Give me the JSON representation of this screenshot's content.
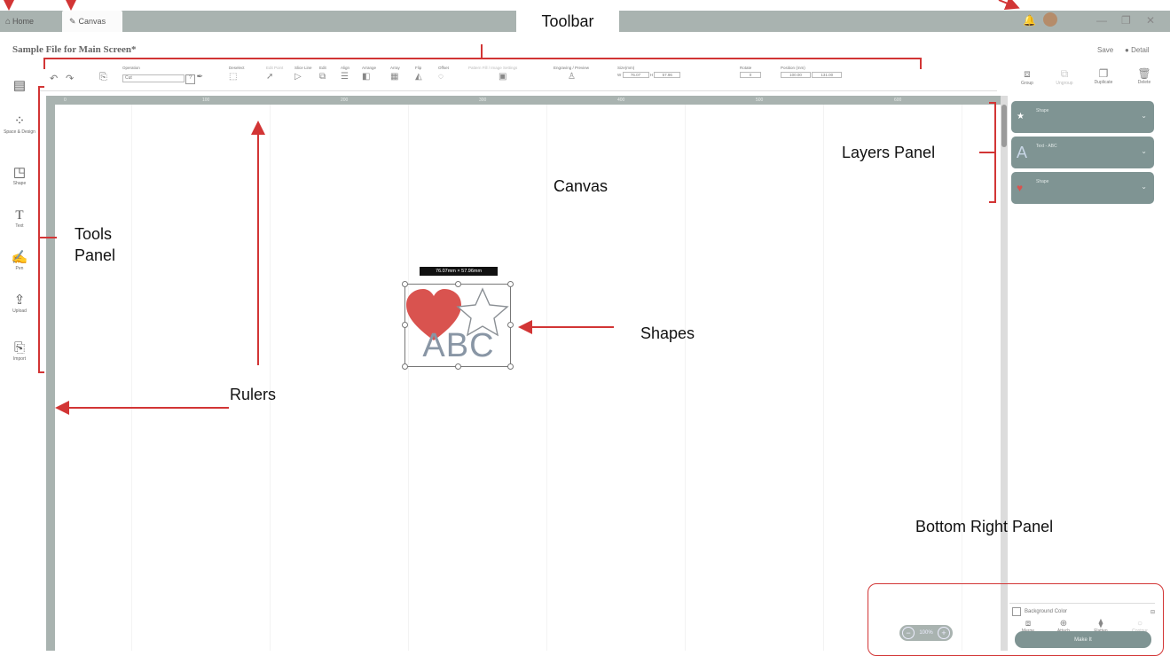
{
  "titlebar": {
    "tabs": [
      {
        "label": "Home",
        "icon": "home-icon"
      },
      {
        "label": "Canvas",
        "icon": "pencil-icon"
      }
    ],
    "window_controls": [
      "minimize-icon",
      "restore-icon",
      "close-icon"
    ]
  },
  "file": {
    "title": "Sample File for Main Screen*",
    "save_label": "Save",
    "detail_label": "Detail"
  },
  "toolbar": {
    "groups": [
      {
        "label": "Operation",
        "value": "Cut"
      },
      {
        "label": "Deselect"
      },
      {
        "label": "Edit Point"
      },
      {
        "label": "Slice Line"
      },
      {
        "label": "Edit"
      },
      {
        "label": "Align"
      },
      {
        "label": "Arrange"
      },
      {
        "label": "Array"
      },
      {
        "label": "Flip"
      },
      {
        "label": "Offset"
      },
      {
        "label": "Pattern Fill / Image Settings"
      },
      {
        "label": "Engraving / Preview"
      },
      {
        "label": "Size(mm)",
        "w_label": "W",
        "w_value": "76.07",
        "h_label": "H",
        "h_value": "57.96"
      },
      {
        "label": "Rotate",
        "value": "0"
      },
      {
        "label": "Position (mm)",
        "x_value": "100.00",
        "y_value": "131.00"
      }
    ]
  },
  "tools": [
    {
      "label": "Templates",
      "icon": "templates-icon"
    },
    {
      "label": "Space & Design",
      "icon": "design-grid-icon"
    },
    {
      "label": "Shape",
      "icon": "shape-icon"
    },
    {
      "label": "Text",
      "icon": "text-icon"
    },
    {
      "label": "Pen",
      "icon": "pen-icon"
    },
    {
      "label": "Upload",
      "icon": "upload-icon"
    },
    {
      "label": "Import",
      "icon": "import-icon"
    }
  ],
  "right_actions": [
    {
      "label": "Group",
      "icon": "group-icon"
    },
    {
      "label": "Ungroup",
      "icon": "ungroup-icon"
    },
    {
      "label": "Duplicate",
      "icon": "duplicate-icon"
    },
    {
      "label": "Delete",
      "icon": "trash-icon"
    }
  ],
  "layers": [
    {
      "name": "Shape",
      "icon": "star-icon"
    },
    {
      "name": "Text - ABC",
      "icon": "text-a-icon"
    },
    {
      "name": "Shape",
      "icon": "heart-icon"
    }
  ],
  "canvas": {
    "dimension_tooltip": "76.07mm × 57.96mm",
    "shape_text": "ABC",
    "ruler_ticks": [
      "0",
      "100",
      "200",
      "300",
      "400",
      "500",
      "600",
      "700"
    ]
  },
  "bottom_right": {
    "background_color_label": "Background Color",
    "actions": [
      {
        "label": "Merge",
        "icon": "merge-icon"
      },
      {
        "label": "Attach",
        "icon": "attach-icon"
      },
      {
        "label": "Flatten",
        "icon": "flatten-icon"
      },
      {
        "label": "Contour",
        "icon": "contour-icon"
      }
    ],
    "make_button": "Make It",
    "zoom_value": "100%"
  },
  "annotations": {
    "toolbar": "Toolbar",
    "tools_panel_line1": "Tools",
    "tools_panel_line2": "Panel",
    "layers_panel": "Layers Panel",
    "canvas": "Canvas",
    "shapes": "Shapes",
    "rulers": "Rulers",
    "bottom_right_panel": "Bottom Right Panel"
  },
  "colors": {
    "chrome": "#a9b3b0",
    "layer_fill": "#7f9493",
    "annotation_red": "#d23535",
    "heart_red": "#d9534f",
    "abc_text": "#8996a5"
  }
}
